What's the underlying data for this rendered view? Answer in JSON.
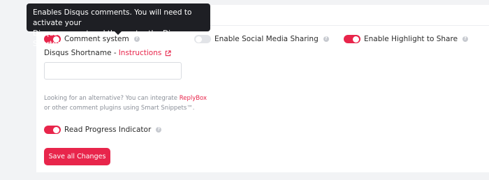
{
  "tooltip": {
    "line1": "Enables Disqus comments. You will need to activate your",
    "line2": "Disqus account and then enter the Disqus Shortname."
  },
  "toggles": {
    "comment_system": {
      "label": "Comment system",
      "on": true
    },
    "social_sharing": {
      "label": "Enable Social Media Sharing",
      "on": false
    },
    "highlight_share": {
      "label": "Enable Highlight to Share",
      "on": true
    },
    "read_progress": {
      "label": "Read Progress Indicator",
      "on": true
    }
  },
  "disqus": {
    "label": "Disqus Shortname -",
    "link": "Instructions",
    "value": "",
    "placeholder": ""
  },
  "alternative": {
    "line1_prefix": "Looking for an alternative? You can integrate",
    "line1_link": "ReplyBox",
    "line2": "or other comment plugins using Smart Snippets™."
  },
  "actions": {
    "save_label": "Save all Changes"
  },
  "colors": {
    "accent": "#e8254b",
    "tooltip_bg": "#1e1f24",
    "page_bg": "#f2f3f5"
  },
  "icons": {
    "help": "question-circle-icon",
    "external": "external-link-icon"
  }
}
